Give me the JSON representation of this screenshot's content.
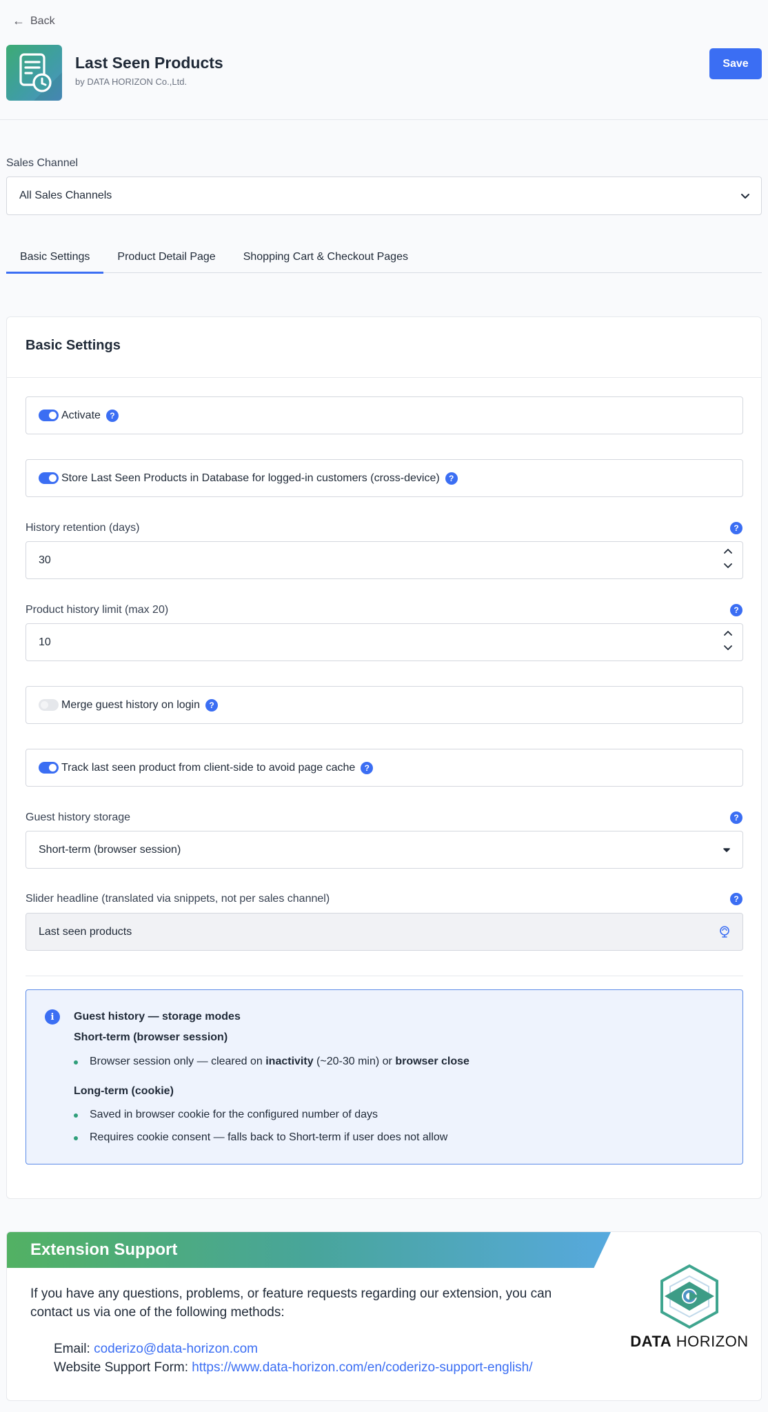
{
  "header": {
    "back_label": "Back",
    "title": "Last Seen Products",
    "vendor": "by DATA HORIZON Co.,Ltd.",
    "save_label": "Save"
  },
  "sales_channel": {
    "label": "Sales Channel",
    "value": "All Sales Channels"
  },
  "tabs": [
    {
      "label": "Basic Settings",
      "active": true
    },
    {
      "label": "Product Detail Page",
      "active": false
    },
    {
      "label": "Shopping Cart & Checkout Pages",
      "active": false
    }
  ],
  "basic": {
    "title": "Basic Settings",
    "activate": {
      "label": "Activate",
      "on": true
    },
    "store_db": {
      "label": "Store Last Seen Products in Database for logged-in customers (cross-device)",
      "on": true
    },
    "retention": {
      "label": "History retention (days)",
      "value": "30"
    },
    "limit": {
      "label": "Product history limit (max 20)",
      "value": "10"
    },
    "merge": {
      "label": "Merge guest history on login",
      "on": false
    },
    "track": {
      "label": "Track last seen product from client-side to avoid page cache",
      "on": true
    },
    "storage": {
      "label": "Guest history storage",
      "value": "Short-term (browser session)"
    },
    "headline": {
      "label": "Slider headline (translated via snippets, not per sales channel)",
      "value": "Last seen products"
    },
    "help_glyph": "?"
  },
  "info": {
    "icon_glyph": "i",
    "title": "Guest history — storage modes",
    "short_heading": "Short-term (browser session)",
    "short_item_a": "Browser session only — cleared on ",
    "short_item_b": "inactivity",
    "short_item_c": " (~20-30 min) or ",
    "short_item_d": "browser close",
    "long_heading": "Long-term (cookie)",
    "long_items": [
      "Saved in browser cookie for the configured number of days",
      "Requires cookie consent — falls back to Short-term if user does not allow"
    ]
  },
  "support": {
    "title": "Extension Support",
    "text": "If you have any questions, problems, or feature requests regarding our extension, you can contact us via one of the following methods:",
    "email_label": "Email: ",
    "email": "coderizo@data-horizon.com",
    "form_label": "Website Support Form: ",
    "form_url": "https://www.data-horizon.com/en/coderizo-support-english/",
    "logo_bold": "DATA",
    "logo_rest": " HORIZON"
  },
  "colors": {
    "accent": "#3b6ef3",
    "brand_green": "#3dab74",
    "brand_blue": "#4c92c4"
  },
  "icons": [
    "back-arrow-icon",
    "app-icon",
    "chevron-down-icon",
    "help-icon",
    "stepper-up-icon",
    "stepper-down-icon",
    "translate-globe-icon",
    "info-icon",
    "data-horizon-logo"
  ]
}
